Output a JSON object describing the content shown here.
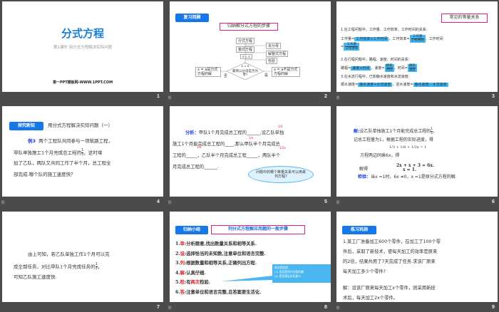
{
  "slides": [
    {
      "number": "1",
      "title": "分式方程",
      "subtitle": "第2课时 用分式方程解决实际问题",
      "footer": "第一PPT模板网-WWW.1PPT.COM"
    },
    {
      "number": "2",
      "level": "阶",
      "badge": "复习回顾",
      "heading": "归纳解分式方程的步骤",
      "flow": {
        "eq1": "分式方程",
        "step1": "去分母",
        "eq2": "整式方程",
        "step2": "解整式方程",
        "root": "x = a",
        "step3": "检验",
        "diamond_top": "x = a",
        "diamond": "最简公分母是否为零?",
        "no": "否",
        "yes": "是",
        "left": "x = a是分式方程的解",
        "right": "x = a不是分式方程的解"
      }
    },
    {
      "number": "3",
      "level": "阶",
      "heading": "常见的等量关系",
      "l1": "1.在工程问题中，工作量、工作效率、工作时间的关系：",
      "work_amount": "工作量=",
      "a1": "工作效率×工作时间",
      "work_eff": "，工作效率=",
      "f_num": "工作量",
      "f_den1": "工作时间",
      "work_time": "，工作时间",
      "eq": "=",
      "f_den2": "工作效率",
      "l2": "2.在行程问题中，路程、速度、时间的关系：",
      "dist": "路程=",
      "a2": "速度×时间",
      "speed": "，速度=",
      "d_num": "路程",
      "d_den1": "时间",
      "time": "，时间=",
      "d_den2": "速度",
      "l3": "3.在水流行程中，已知静水速度和水流速度：",
      "down": "顺水速度=",
      "a3": "静水速度+水流速度",
      "up": "，逆水速度=",
      "a4": "静水速度－水流速度"
    },
    {
      "number": "4",
      "level": "阶",
      "badge": "探究新知",
      "heading": "用分式方程解决实际问题（一）",
      "example": "例3",
      "text1": "两个工程队共同参与一项筑路工程，",
      "text2": "甲队单独施工1个月完成总工程的",
      "frac_n": "1",
      "frac_d": "3",
      "text3": "，这时增",
      "text4": "加了乙队，两队又共同工作了半个月，总工程全",
      "text5": "部完成.哪个队的施工速度快？"
    },
    {
      "number": "5",
      "level": "阶",
      "label": "分析：",
      "l1": "甲队1个月完成总工程的______,设乙队单独",
      "l2": "施工1个月能完成总工程的____,那么甲队半个月完成总",
      "l3": "工程的_____，乙队半个月完成总工程_____，两队半个",
      "l4": "月完成总工程的______.",
      "a1": "1/3",
      "a2": "1/x",
      "a3": "1/6",
      "a4": "1/2x",
      "cloud": "问题中的哪个等量关系可以用来列方程?"
    },
    {
      "number": "6",
      "level": "阶",
      "solve": "解:",
      "l1": "设乙队单独施工1个月能完成总工程的",
      "fx_n": "1",
      "fx_d": "x",
      "l1b": "，",
      "l2": "记总工程量为1，根据工程的实际进度，得",
      "eq1": "1/3 + 1/6 + 1/2x = 1",
      "l3": "方程两边同乘6x，得",
      "eq2": "2x + x + 3 = 6x.",
      "l4": "解得",
      "eq3": "x = 1.",
      "check": "检验：",
      "l5": "当x =1时，6x ≠0，x =1是原分式方程的解."
    },
    {
      "number": "7",
      "l1": "由上可知，若乙队单独工作1个月可以完",
      "l2": "成全部任务，对比甲队1个月完成任务的",
      "frac_n": "1",
      "frac_d": "3",
      "l2b": "，",
      "l3": "可知乙队施工速度快."
    },
    {
      "number": "8",
      "level": "阶",
      "badge": "归纳小结",
      "heading": "列分式方程解应用题的一般步骤",
      "steps": [
        {
          "n": "1.",
          "k": "审",
          "t": ":分析题意,找出数量关系和相等关系."
        },
        {
          "n": "2.",
          "k": "设",
          "t": ":选择恰当的未知数,注意单位和语言完整."
        },
        {
          "n": "3.",
          "k": "列",
          "t": ":根据数量和相等关系,正确列出方程."
        },
        {
          "n": "4.",
          "k": "解",
          "t": ":认真仔细."
        },
        {
          "n": "5.",
          "k": "检",
          "t": ":有",
          "r": "两次",
          "t2": "检验."
        },
        {
          "n": "6.",
          "k": "答",
          "t": ":注意单位和语言完整,且答案要生活化."
        }
      ],
      "callout": [
        "两次检验是:",
        "(1) 是否是所列方程的解;",
        "(2) 是否满足实际意义."
      ]
    },
    {
      "number": "9",
      "level": "阶",
      "badge": "练习巩固",
      "p1": "1.某工厂准备加工600个零件，在加工了100个零",
      "p2": "件后，采取了新技术，使每天加工的效率是原来",
      "p3": "的2倍，结果共用了7天完成了任务.求该厂原来",
      "p4": "每天加工多少个零件?",
      "s1": "解：设该厂原来每天加工x个零件，则采用新技",
      "s2": "术后，每天加工2x个零件。"
    }
  ]
}
